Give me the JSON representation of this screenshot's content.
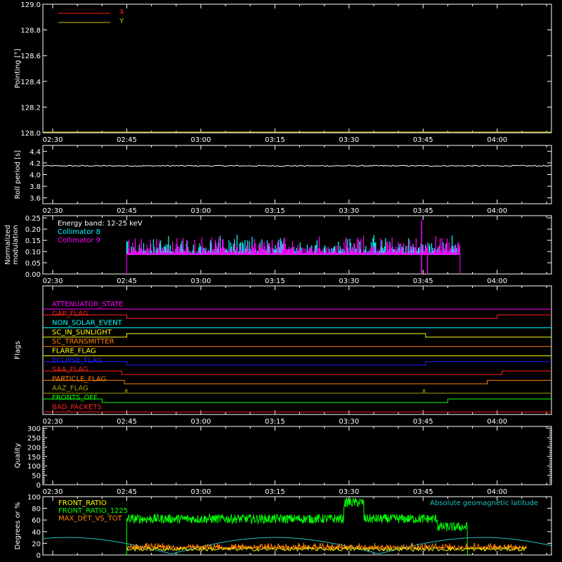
{
  "time_ticks": [
    "02:30",
    "02:45",
    "03:00",
    "03:15",
    "03:30",
    "03:45",
    "04:00"
  ],
  "time_range_hours": [
    2.4667,
    4.1833
  ],
  "chart_data": [
    {
      "type": "line",
      "ylabel": "Pointing [°]",
      "ylim": [
        128.0,
        129.0
      ],
      "yticks": [
        "128.0",
        "128.2",
        "128.4",
        "128.6",
        "128.8",
        "129.0"
      ],
      "yvals": [
        128.0,
        128.2,
        128.4,
        128.6,
        128.8,
        129.0
      ],
      "legend": [
        {
          "name": "X",
          "color": "#ff2020"
        },
        {
          "name": "Y",
          "color": "#c8c800"
        }
      ],
      "series": [
        {
          "name": "X",
          "color": "#ff2020",
          "x": [
            2.4667,
            4.1833
          ],
          "y": [
            128.0,
            128.0
          ]
        },
        {
          "name": "Y",
          "color": "#c8c800",
          "x": [
            2.4667,
            4.1833
          ],
          "y": [
            128.0,
            128.0
          ]
        }
      ]
    },
    {
      "type": "line",
      "ylabel": "Roll period [s]",
      "ylim": [
        3.5,
        4.5
      ],
      "yticks": [
        "3.6",
        "3.8",
        "4.0",
        "4.2",
        "4.4"
      ],
      "yvals": [
        3.6,
        3.8,
        4.0,
        4.2,
        4.4
      ],
      "series": [
        {
          "name": "roll",
          "color": "#ffffff",
          "x": [
            2.4667,
            4.1833
          ],
          "y": [
            4.15,
            4.15
          ]
        }
      ]
    },
    {
      "type": "bar",
      "ylabel": "Normalized modulation",
      "ylabel_lines": [
        "Normalized",
        "modulation"
      ],
      "ylim": [
        0.0,
        0.26
      ],
      "yticks": [
        "0.00",
        "0.05",
        "0.10",
        "0.15",
        "0.20",
        "0.25"
      ],
      "yvals": [
        0,
        0.05,
        0.1,
        0.15,
        0.2,
        0.25
      ],
      "annotation": "Energy band: 12-25 keV",
      "legend": [
        {
          "name": "Collimator 8",
          "color": "#00ffff"
        },
        {
          "name": "Collimator 9",
          "color": "#ff00ff"
        }
      ],
      "data_window_hours": [
        2.75,
        3.875
      ],
      "baseline": 0.09,
      "typical_peak": 0.15,
      "max_value": 0.24
    },
    {
      "type": "line",
      "ylabel": "Flags",
      "flags": [
        {
          "name": "ATTENUATOR_STATE",
          "color": "#ff00ff",
          "steps": [
            [
              2.4667,
              0
            ],
            [
              4.1833,
              0
            ]
          ]
        },
        {
          "name": "GAP_FLAG",
          "color": "#ff2020",
          "steps": [
            [
              2.4667,
              1
            ],
            [
              2.75,
              0
            ],
            [
              4.0,
              1
            ],
            [
              4.1833,
              1
            ]
          ]
        },
        {
          "name": "NON_SOLAR_EVENT",
          "color": "#00ffff",
          "steps": [
            [
              2.4667,
              0
            ],
            [
              4.1833,
              0
            ]
          ]
        },
        {
          "name": "SC_IN_SUNLIGHT",
          "color": "#ffff00",
          "steps": [
            [
              2.4667,
              0
            ],
            [
              2.75,
              1
            ],
            [
              3.7583,
              0
            ],
            [
              4.1833,
              0
            ]
          ]
        },
        {
          "name": "SC_TRANSMITTER",
          "color": "#ff8000",
          "steps": [
            [
              2.4667,
              0
            ],
            [
              4.1833,
              0
            ]
          ]
        },
        {
          "name": "FLARE_FLAG",
          "color": "#ffff00",
          "steps": [
            [
              2.4667,
              0
            ],
            [
              4.1833,
              0
            ]
          ]
        },
        {
          "name": "ECLIPSE_FLAG",
          "color": "#2020ff",
          "steps": [
            [
              2.4667,
              1
            ],
            [
              2.75,
              0
            ],
            [
              3.7583,
              1
            ],
            [
              4.1833,
              1
            ]
          ]
        },
        {
          "name": "SAA_FLAG",
          "color": "#ff2020",
          "steps": [
            [
              2.4667,
              1
            ],
            [
              2.7333,
              0
            ],
            [
              4.0167,
              1
            ],
            [
              4.1833,
              1
            ]
          ]
        },
        {
          "name": "PARTICLE_FLAG",
          "color": "#ff8000",
          "steps": [
            [
              2.4667,
              1
            ],
            [
              2.7417,
              0
            ],
            [
              3.9667,
              1
            ],
            [
              4.1833,
              1
            ]
          ]
        },
        {
          "name": "AAZ_FLAG",
          "color": "#a0a000",
          "steps": [
            [
              2.4667,
              0
            ],
            [
              2.7458,
              1
            ],
            [
              2.7508,
              0
            ],
            [
              3.7508,
              1
            ],
            [
              3.7558,
              0
            ],
            [
              4.1833,
              0
            ]
          ]
        },
        {
          "name": "FRONTS_OFF",
          "color": "#00ff00",
          "steps": [
            [
              2.4667,
              1
            ],
            [
              2.6667,
              0
            ],
            [
              3.8333,
              1
            ],
            [
              4.1833,
              1
            ]
          ]
        },
        {
          "name": "BAD_PACKETS",
          "color": "#ff2020",
          "steps": [
            [
              2.4667,
              0
            ],
            [
              4.1833,
              0
            ]
          ]
        }
      ]
    },
    {
      "type": "line",
      "ylabel": "Quality",
      "ylim": [
        0,
        310
      ],
      "yticks": [
        "0",
        "50",
        "100",
        "150",
        "200",
        "250",
        "300"
      ],
      "yvals": [
        0,
        50,
        100,
        150,
        200,
        250,
        300
      ],
      "series": []
    },
    {
      "type": "line",
      "ylabel": "Degrees or %",
      "ylim": [
        0,
        100
      ],
      "yticks": [
        "0",
        "20",
        "40",
        "60",
        "80",
        "100"
      ],
      "yvals": [
        0,
        20,
        40,
        60,
        80,
        100
      ],
      "annotation": "Absolute geomagnetic latitude",
      "legend": [
        {
          "name": "FRONT_RATIO",
          "color": "#ffff00"
        },
        {
          "name": "FRONT_RATIO_1225",
          "color": "#00ff00"
        },
        {
          "name": "MAX_DET_VS_TOT",
          "color": "#ff8000"
        }
      ],
      "series_summary": {
        "FRONT_RATIO_1225": {
          "window": [
            2.75,
            3.9
          ],
          "typical": 62,
          "bump_window": [
            3.4833,
            3.55
          ],
          "bump_value": 90
        },
        "MAX_DET_VS_TOT": {
          "window": [
            2.75,
            4.1
          ],
          "typical": 12
        },
        "FRONT_RATIO": {
          "window": [
            2.75,
            4.1
          ],
          "typical": 10
        },
        "geomagnetic_latitude": {
          "color": "#20c0c0",
          "peak": 30,
          "min": 2,
          "period_hours": 0.7
        }
      }
    }
  ]
}
